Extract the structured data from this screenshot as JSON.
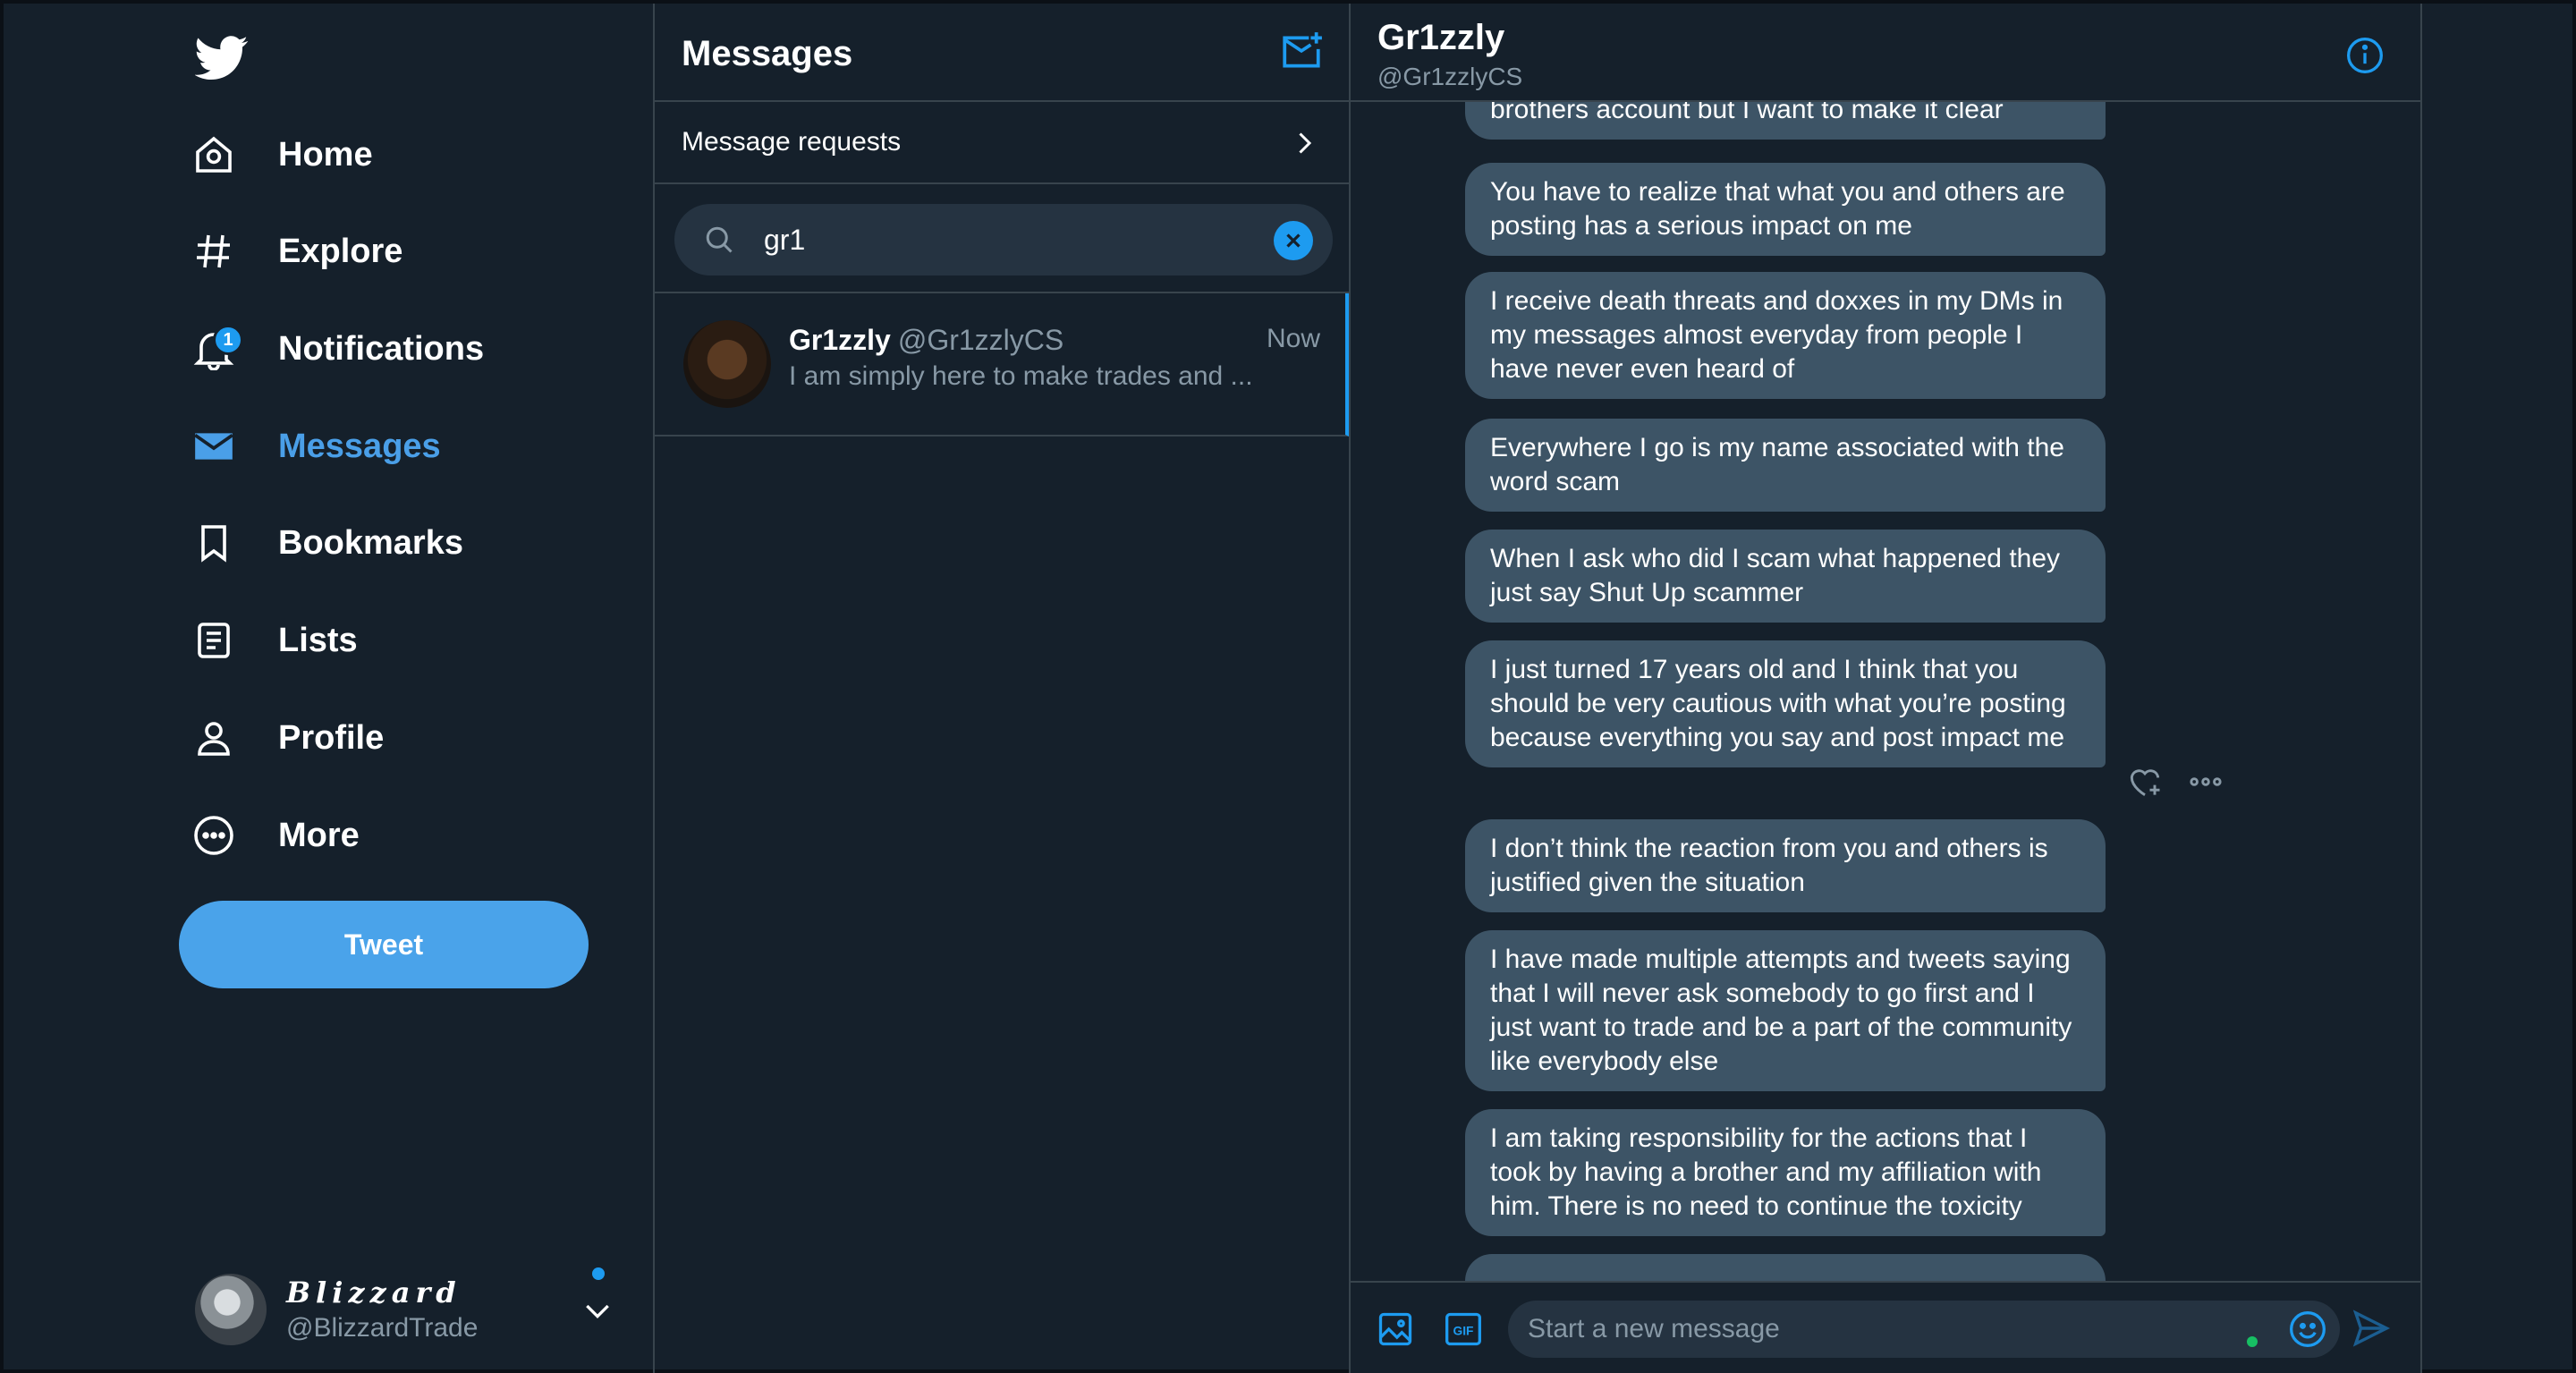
{
  "sidebar": {
    "nav": [
      {
        "label": "Home",
        "icon": "home-icon"
      },
      {
        "label": "Explore",
        "icon": "hashtag-icon"
      },
      {
        "label": "Notifications",
        "icon": "bell-icon",
        "badge": "1"
      },
      {
        "label": "Messages",
        "icon": "envelope-icon",
        "active": true
      },
      {
        "label": "Bookmarks",
        "icon": "bookmark-icon"
      },
      {
        "label": "Lists",
        "icon": "list-icon"
      },
      {
        "label": "Profile",
        "icon": "person-icon"
      },
      {
        "label": "More",
        "icon": "more-circle-icon"
      }
    ],
    "tweet_label": "Tweet",
    "account": {
      "display_name": "Blizzard",
      "handle": "@BlizzardTrade"
    }
  },
  "messages_panel": {
    "title": "Messages",
    "requests_label": "Message requests",
    "search": {
      "value": "gr1"
    },
    "conversation": {
      "name": "Gr1zzly",
      "handle": "@Gr1zzlyCS",
      "time": "Now",
      "preview": "I am simply here to make trades and ..."
    }
  },
  "chat": {
    "name": "Gr1zzly",
    "handle": "@Gr1zzlyCS",
    "messages": [
      "brothers account but I want to make it clear",
      "You have to realize that what you and others are posting has a serious impact on me",
      "I receive death threats and doxxes in my DMs in my messages almost everyday from people I have never even heard of",
      "Everywhere I go is my name associated with the word scam",
      "When I ask who did I scam what happened they just say Shut Up scammer",
      "I just turned 17 years old and I think that you should be very cautious with what you’re posting because everything you say and post impact me",
      "I don’t think the reaction from you and others is justified given the situation",
      "I have made multiple attempts and tweets saying that I will never ask somebody to go first and I just want to trade and be a part of the community like everybody else",
      "I am taking responsibility for the actions that I took by having a brother and my affiliation with him. There is no need to continue the toxicity",
      ""
    ],
    "composer_placeholder": "Start a new message"
  },
  "colors": {
    "accent": "#1d9bf0",
    "background": "#15202b",
    "bubble": "#3d5466",
    "border": "#38444d",
    "muted": "#8899a6"
  }
}
